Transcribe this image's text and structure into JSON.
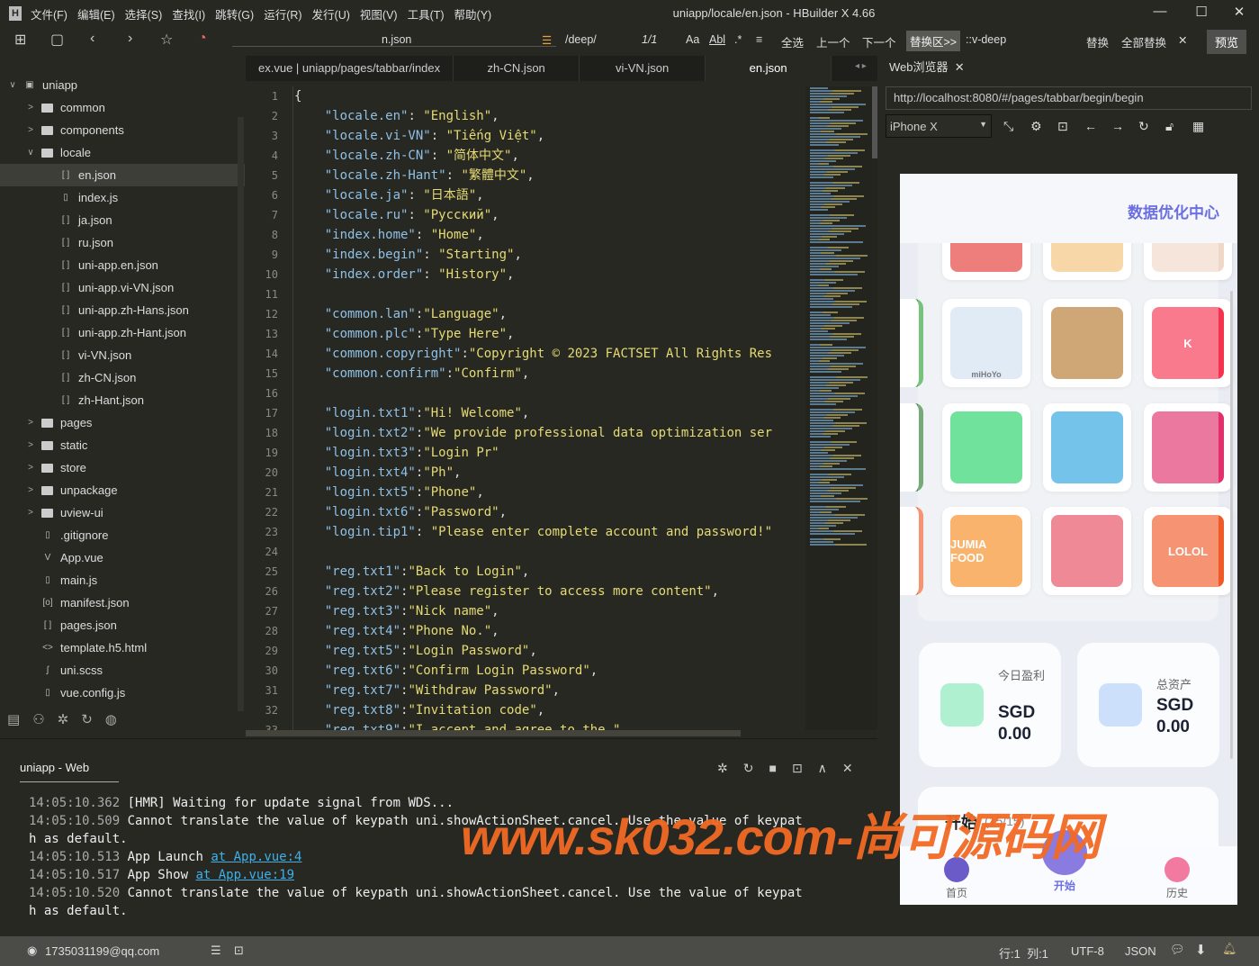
{
  "window": {
    "title": "uniapp/locale/en.json - HBuilder X 4.66",
    "logo": "H",
    "minimize": "—",
    "maximize": "☐",
    "close": "✕"
  },
  "menu": [
    "文件(F)",
    "编辑(E)",
    "选择(S)",
    "查找(I)",
    "跳转(G)",
    "运行(R)",
    "发行(U)",
    "视图(V)",
    "工具(T)",
    "帮助(Y)"
  ],
  "toolbar": {
    "file_field": "n.json",
    "search_value": "/deep/",
    "match_count": "1/1",
    "case": "Aa",
    "word": "Abl",
    "regex": ".*",
    "select_all": "全选",
    "prev": "上一个",
    "next": "下一个",
    "replace_area": "替换区>>",
    "replace_value": "::v-deep",
    "replace": "替换",
    "replace_all": "全部替换",
    "close": "✕",
    "preview": "预览"
  },
  "sidebar": {
    "items": [
      {
        "label": "uniapp",
        "type": "root",
        "depth": 0,
        "chev": "∨"
      },
      {
        "label": "common",
        "type": "folder",
        "depth": 1,
        "chev": ">"
      },
      {
        "label": "components",
        "type": "folder",
        "depth": 1,
        "chev": ">"
      },
      {
        "label": "locale",
        "type": "folder",
        "depth": 1,
        "chev": "∨"
      },
      {
        "label": "en.json",
        "type": "json",
        "depth": 2,
        "selected": true
      },
      {
        "label": "index.js",
        "type": "js",
        "depth": 2
      },
      {
        "label": "ja.json",
        "type": "json",
        "depth": 2
      },
      {
        "label": "ru.json",
        "type": "json",
        "depth": 2
      },
      {
        "label": "uni-app.en.json",
        "type": "json",
        "depth": 2
      },
      {
        "label": "uni-app.vi-VN.json",
        "type": "json",
        "depth": 2
      },
      {
        "label": "uni-app.zh-Hans.json",
        "type": "json",
        "depth": 2
      },
      {
        "label": "uni-app.zh-Hant.json",
        "type": "json",
        "depth": 2
      },
      {
        "label": "vi-VN.json",
        "type": "json",
        "depth": 2
      },
      {
        "label": "zh-CN.json",
        "type": "json",
        "depth": 2
      },
      {
        "label": "zh-Hant.json",
        "type": "json",
        "depth": 2
      },
      {
        "label": "pages",
        "type": "folder",
        "depth": 1,
        "chev": ">"
      },
      {
        "label": "static",
        "type": "folder",
        "depth": 1,
        "chev": ">"
      },
      {
        "label": "store",
        "type": "folder",
        "depth": 1,
        "chev": ">"
      },
      {
        "label": "unpackage",
        "type": "folder",
        "depth": 1,
        "chev": ">"
      },
      {
        "label": "uview-ui",
        "type": "folder",
        "depth": 1,
        "chev": ">"
      },
      {
        "label": ".gitignore",
        "type": "file",
        "depth": 1
      },
      {
        "label": "App.vue",
        "type": "vue",
        "depth": 1
      },
      {
        "label": "main.js",
        "type": "js",
        "depth": 1
      },
      {
        "label": "manifest.json",
        "type": "manifest",
        "depth": 1
      },
      {
        "label": "pages.json",
        "type": "json",
        "depth": 1
      },
      {
        "label": "template.h5.html",
        "type": "html",
        "depth": 1
      },
      {
        "label": "uni.scss",
        "type": "scss",
        "depth": 1
      },
      {
        "label": "vue.config.js",
        "type": "js",
        "depth": 1
      }
    ]
  },
  "editor": {
    "tabs": [
      {
        "label": "ex.vue | uniapp/pages/tabbar/index"
      },
      {
        "label": "zh-CN.json"
      },
      {
        "label": "vi-VN.json"
      },
      {
        "label": "en.json",
        "active": true
      }
    ],
    "lines": [
      {
        "p": "{"
      },
      {
        "k": "\"locale.en\"",
        "s": ": ",
        "v": "\"English\"",
        "e": ","
      },
      {
        "k": "\"locale.vi-VN\"",
        "s": ": ",
        "v": "\"Tiếng Việt\"",
        "e": ","
      },
      {
        "k": "\"locale.zh-CN\"",
        "s": ": ",
        "v": "\"简体中文\"",
        "e": ","
      },
      {
        "k": "\"locale.zh-Hant\"",
        "s": ": ",
        "v": "\"繁體中文\"",
        "e": ","
      },
      {
        "k": "\"locale.ja\"",
        "s": ": ",
        "v": "\"日本語\"",
        "e": ","
      },
      {
        "k": "\"locale.ru\"",
        "s": ": ",
        "v": "\"Русский\"",
        "e": ","
      },
      {
        "k": "\"index.home\"",
        "s": ": ",
        "v": "\"Home\"",
        "e": ","
      },
      {
        "k": "\"index.begin\"",
        "s": ": ",
        "v": "\"Starting\"",
        "e": ","
      },
      {
        "k": "\"index.order\"",
        "s": ": ",
        "v": "\"History\"",
        "e": ","
      },
      {},
      {
        "k": "\"common.lan\"",
        "s": ":",
        "v": "\"Language\"",
        "e": ","
      },
      {
        "k": "\"common.plc\"",
        "s": ":",
        "v": "\"Type Here\"",
        "e": ","
      },
      {
        "k": "\"common.copyright\"",
        "s": ":",
        "v": "\"Copyright © 2023 FACTSET All Rights Res",
        "e": ""
      },
      {
        "k": "\"common.confirm\"",
        "s": ":",
        "v": "\"Confirm\"",
        "e": ","
      },
      {},
      {
        "k": "\"login.txt1\"",
        "s": ":",
        "v": "\"Hi! Welcome\"",
        "e": ","
      },
      {
        "k": "\"login.txt2\"",
        "s": ":",
        "v": "\"We provide professional data optimization ser",
        "e": ""
      },
      {
        "k": "\"login.txt3\"",
        "s": ":",
        "v": "\"Login Pr\"",
        "e": ""
      },
      {
        "k": "\"login.txt4\"",
        "s": ":",
        "v": "\"Ph\"",
        "e": ","
      },
      {
        "k": "\"login.txt5\"",
        "s": ":",
        "v": "\"Phone\"",
        "e": ","
      },
      {
        "k": "\"login.txt6\"",
        "s": ":",
        "v": "\"Password\"",
        "e": ","
      },
      {
        "k": "\"login.tip1\"",
        "s": ": ",
        "v": "\"Please enter complete account and password!\"",
        "e": ""
      },
      {},
      {
        "k": "\"reg.txt1\"",
        "s": ":",
        "v": "\"Back to Login\"",
        "e": ","
      },
      {
        "k": "\"reg.txt2\"",
        "s": ":",
        "v": "\"Please register to access more content\"",
        "e": ","
      },
      {
        "k": "\"reg.txt3\"",
        "s": ":",
        "v": "\"Nick name\"",
        "e": ","
      },
      {
        "k": "\"reg.txt4\"",
        "s": ":",
        "v": "\"Phone No.\"",
        "e": ","
      },
      {
        "k": "\"reg.txt5\"",
        "s": ":",
        "v": "\"Login Password\"",
        "e": ","
      },
      {
        "k": "\"reg.txt6\"",
        "s": ":",
        "v": "\"Confirm Login Password\"",
        "e": ","
      },
      {
        "k": "\"reg.txt7\"",
        "s": ":",
        "v": "\"Withdraw Password\"",
        "e": ","
      },
      {
        "k": "\"reg.txt8\"",
        "s": ":",
        "v": "\"Invitation code\"",
        "e": ","
      },
      {
        "k": "\"reg.txt9\"",
        "s": ":",
        "v": "\"I accept and agree to the \"",
        "e": ""
      }
    ]
  },
  "browser": {
    "tab_label": "Web浏览器",
    "tab_close": "✕",
    "url": "http://localhost:8080/#/pages/tabbar/begin/begin",
    "device": "iPhone X"
  },
  "app": {
    "header_title": "数据优化中心",
    "apps": [
      {
        "label": "",
        "color": "#e53935"
      },
      {
        "label": "",
        "color": "#f3c27a"
      },
      {
        "label": "",
        "color": "#f0d8c8"
      },
      {
        "label": "miHoYo",
        "color": "#cfe0f2"
      },
      {
        "label": "",
        "color": "#b5772b"
      },
      {
        "label": "K",
        "color": "#f5334f"
      },
      {
        "label": "",
        "color": "#25d366"
      },
      {
        "label": "",
        "color": "#2aa3e0"
      },
      {
        "label": "",
        "color": "#e1306c"
      },
      {
        "label": "JUMIA FOOD",
        "color": "#f68b1e"
      },
      {
        "label": "",
        "color": "#e84a5f"
      },
      {
        "label": "LOLOL",
        "color": "#f05a28"
      }
    ],
    "stats": [
      {
        "label": "今日盈利",
        "value": "SGD 0.00",
        "color": "#aef0cf"
      },
      {
        "label": "总资产",
        "value": "SGD 0.00",
        "color": "#cde0fb"
      }
    ],
    "section_title": "开始",
    "section_count": "(15/15)",
    "tabbar": [
      {
        "label": "首页"
      },
      {
        "label": "开始",
        "active": true
      },
      {
        "label": "历史"
      }
    ]
  },
  "console": {
    "tab": "uniapp - Web",
    "lines": [
      {
        "ts": "14:05:10.362",
        "msg": " [HMR] Waiting for update signal from WDS..."
      },
      {
        "ts": "14:05:10.509",
        "msg": " Cannot translate the value of keypath uni.showActionSheet.cancel. Use the value of keypat"
      },
      {
        "ts": "",
        "msg": "h as default."
      },
      {
        "ts": "14:05:10.513",
        "msg": " App Launch ",
        "link": "at App.vue:4"
      },
      {
        "ts": "14:05:10.517",
        "msg": " App Show ",
        "link": "at App.vue:19"
      },
      {
        "ts": "14:05:10.520",
        "msg": " Cannot translate the value of keypath uni.showActionSheet.cancel. Use the value of keypat"
      },
      {
        "ts": "",
        "msg": "h as default."
      }
    ]
  },
  "status": {
    "user": "1735031199@qq.com",
    "position": "行:1  列:1",
    "encoding": "UTF-8",
    "language": "JSON"
  },
  "watermark": "www.sk032.com-尚可源码网",
  "colors": {
    "accent": "#6b6fe0",
    "key": "#8fc1e8",
    "string": "#e6db74",
    "watermark": "#f26a24"
  }
}
